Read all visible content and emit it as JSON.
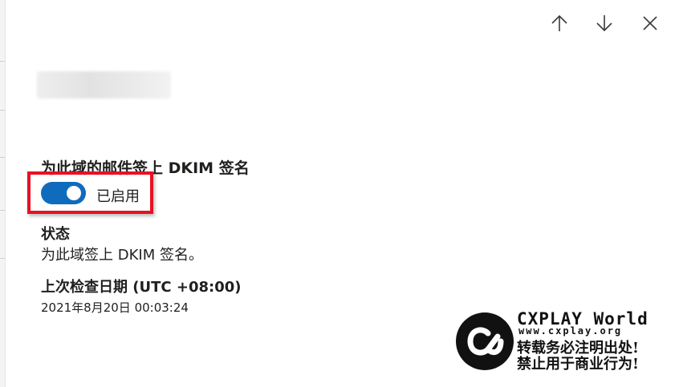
{
  "header": {
    "up_icon": "arrow-up-icon",
    "down_icon": "arrow-down-icon",
    "close_icon": "close-icon"
  },
  "dkim": {
    "sign_label": "为此域的邮件签上 DKIM 签名",
    "toggle_state": "已启用",
    "toggle_on": true
  },
  "status": {
    "title": "状态",
    "value": "为此域签上 DKIM 签名。"
  },
  "last_checked": {
    "title": "上次检查日期 (UTC +08:00)",
    "value": "2021年8月20日 00:03:24"
  },
  "watermark": {
    "title": "CXPLAY World",
    "url": "www.cxplay.org",
    "line1": "转载务必注明出处!",
    "line2": "禁止用于商业行为!"
  },
  "colors": {
    "toggle_on": "#0f6cbd",
    "highlight": "#e81123"
  }
}
